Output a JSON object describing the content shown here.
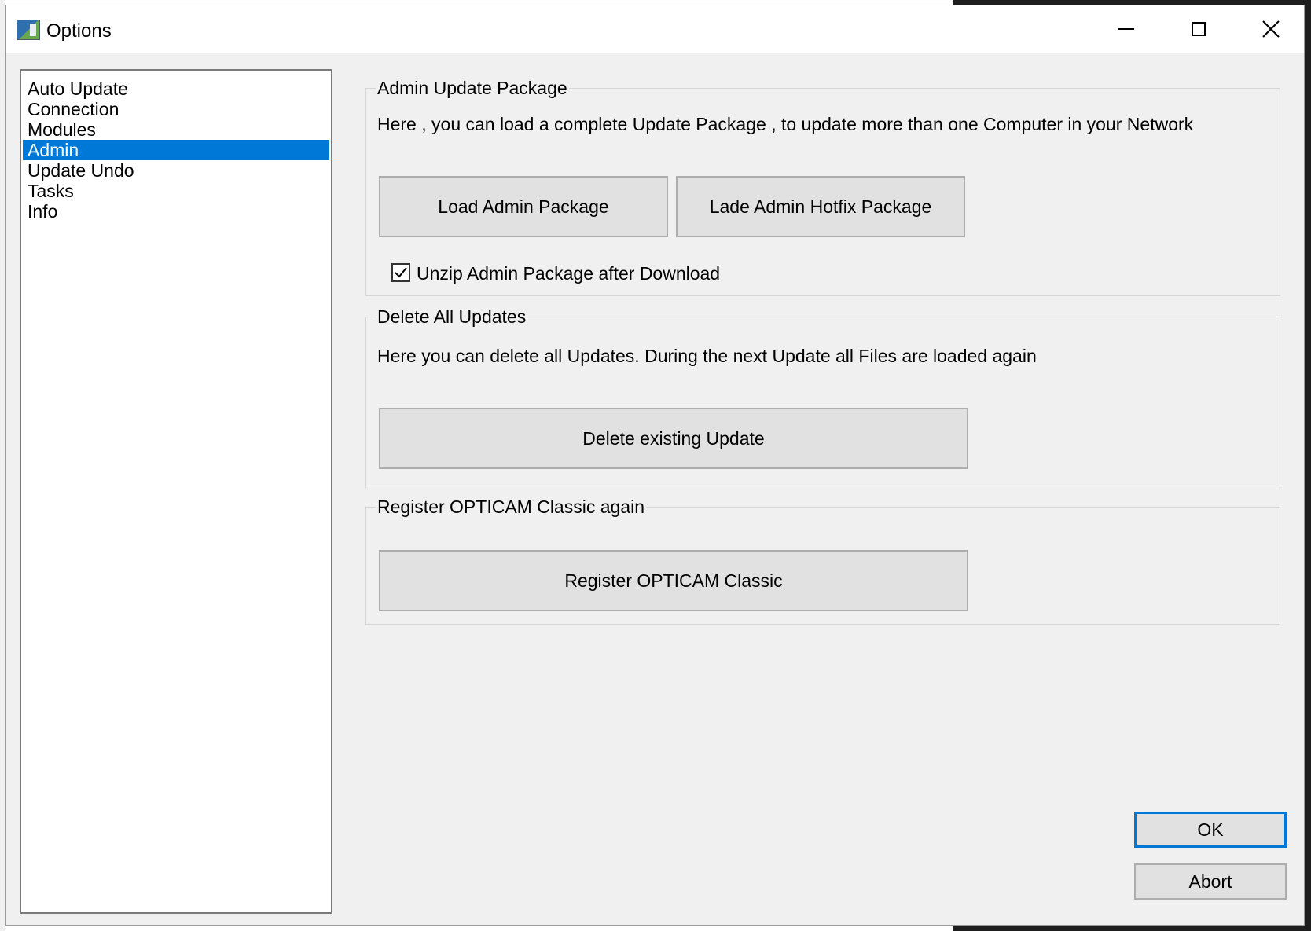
{
  "window": {
    "title": "Options",
    "minimize_icon": "minimize-icon",
    "maximize_icon": "maximize-icon",
    "close_icon": "close-icon"
  },
  "sidebar": {
    "items": [
      {
        "label": "Auto Update",
        "selected": false
      },
      {
        "label": "Connection",
        "selected": false
      },
      {
        "label": "Modules",
        "selected": false
      },
      {
        "label": "Admin",
        "selected": true
      },
      {
        "label": "Update Undo",
        "selected": false
      },
      {
        "label": "Tasks",
        "selected": false
      },
      {
        "label": "Info",
        "selected": false
      }
    ]
  },
  "admin_package": {
    "title": "Admin Update Package",
    "description": "Here , you can load a complete Update Package , to update more than one Computer in your Network",
    "load_button": "Load Admin Package",
    "hotfix_button": "Lade Admin Hotfix Package",
    "unzip_label": "Unzip Admin Package after Download",
    "unzip_checked": true
  },
  "delete_updates": {
    "title": "Delete All Updates",
    "description": "Here you can delete all Updates. During the next Update all Files are loaded again",
    "delete_button": "Delete existing Update"
  },
  "register": {
    "title": "Register OPTICAM Classic again",
    "register_button": "Register OPTICAM Classic"
  },
  "footer": {
    "ok_label": "OK",
    "abort_label": "Abort"
  },
  "colors": {
    "selection": "#0078d7",
    "window_bg": "#f0f0f0",
    "button_bg": "#e1e1e1"
  }
}
